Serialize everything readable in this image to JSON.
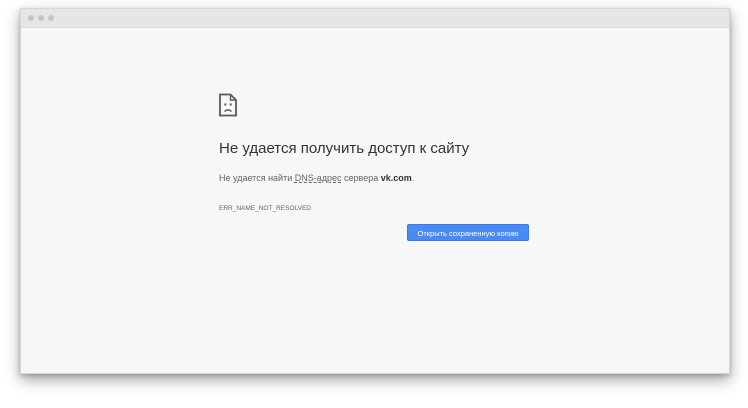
{
  "error_page": {
    "icon": "sad-page-icon",
    "heading": "Не удается получить доступ к сайту",
    "message_prefix": "Не удается найти",
    "dns_link": "DNS-адрес",
    "message_mid": "сервера",
    "host": "vk.com",
    "message_suffix": ".",
    "error_code": "ERR_NAME_NOT_RESOLVED",
    "cached_button_label": "Открыть сохраненную копию"
  },
  "colors": {
    "page_background": "#f7f7f7",
    "button_background": "#4a8af4",
    "heading_text": "#333333",
    "body_text": "#646464"
  }
}
